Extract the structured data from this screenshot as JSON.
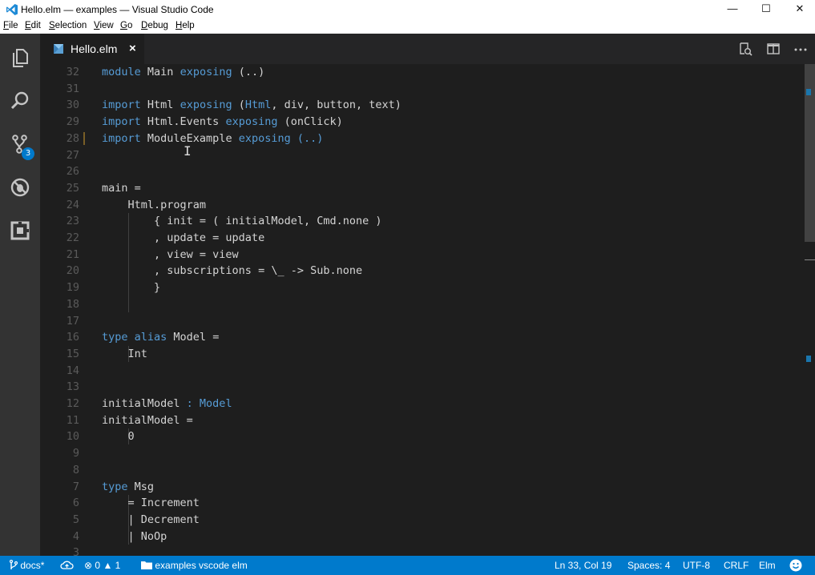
{
  "window": {
    "title": "Hello.elm — examples — Visual Studio Code",
    "minimize": "—",
    "maximize": "☐",
    "close": "✕"
  },
  "menu": [
    {
      "mnemonic": "F",
      "rest": "ile"
    },
    {
      "mnemonic": "E",
      "rest": "dit"
    },
    {
      "mnemonic": "S",
      "rest": "election"
    },
    {
      "mnemonic": "V",
      "rest": "iew"
    },
    {
      "mnemonic": "G",
      "rest": "o"
    },
    {
      "mnemonic": "D",
      "rest": "ebug"
    },
    {
      "mnemonic": "H",
      "rest": "elp"
    }
  ],
  "activity": {
    "icons": [
      "explorer-icon",
      "search-icon",
      "source-control-icon",
      "debug-icon",
      "extensions-icon"
    ],
    "scm_badge": "3"
  },
  "tab": {
    "label": "Hello.elm",
    "close": "×"
  },
  "editor": {
    "lines": [
      {
        "num": "32",
        "tokens": [
          {
            "t": "module",
            "c": "kw"
          },
          {
            "t": " Main "
          },
          {
            "t": "exposing",
            "c": "kw"
          },
          {
            "t": " (..)"
          }
        ]
      },
      {
        "num": "31",
        "tokens": []
      },
      {
        "num": "30",
        "tokens": [
          {
            "t": "import",
            "c": "kw"
          },
          {
            "t": " Html "
          },
          {
            "t": "exposing",
            "c": "kw"
          },
          {
            "t": " ("
          },
          {
            "t": "Html",
            "c": "kw"
          },
          {
            "t": ", div, button, text)"
          }
        ]
      },
      {
        "num": "29",
        "tokens": [
          {
            "t": "import",
            "c": "kw"
          },
          {
            "t": " Html.Events "
          },
          {
            "t": "exposing",
            "c": "kw"
          },
          {
            "t": " (onClick)"
          }
        ]
      },
      {
        "num": "28",
        "tokens": [
          {
            "t": "import",
            "c": "kw"
          },
          {
            "t": " ModuleExample "
          },
          {
            "t": "exposing",
            "c": "kw"
          },
          {
            "t": " (..)",
            "c": "kw"
          }
        ],
        "modified": true
      },
      {
        "num": "27",
        "tokens": []
      },
      {
        "num": "26",
        "tokens": []
      },
      {
        "num": "25",
        "tokens": [
          {
            "t": "main ="
          }
        ]
      },
      {
        "num": "24",
        "tokens": [
          {
            "t": "    Html.program"
          }
        ]
      },
      {
        "num": "23",
        "tokens": [
          {
            "t": "        { init = ( initialModel, Cmd.none )"
          }
        ]
      },
      {
        "num": "22",
        "tokens": [
          {
            "t": "        , update = update"
          }
        ]
      },
      {
        "num": "21",
        "tokens": [
          {
            "t": "        , view = view"
          }
        ]
      },
      {
        "num": "20",
        "tokens": [
          {
            "t": "        , subscriptions = \\_ -> Sub.none"
          }
        ]
      },
      {
        "num": "19",
        "tokens": [
          {
            "t": "        }"
          }
        ]
      },
      {
        "num": "18",
        "tokens": []
      },
      {
        "num": "17",
        "tokens": []
      },
      {
        "num": "16",
        "tokens": [
          {
            "t": "type",
            "c": "kw"
          },
          {
            "t": " "
          },
          {
            "t": "alias",
            "c": "kw"
          },
          {
            "t": " Model ="
          }
        ]
      },
      {
        "num": "15",
        "tokens": [
          {
            "t": "    Int"
          }
        ]
      },
      {
        "num": "14",
        "tokens": []
      },
      {
        "num": "13",
        "tokens": []
      },
      {
        "num": "12",
        "tokens": [
          {
            "t": "initialModel "
          },
          {
            "t": ": Model",
            "c": "kw"
          }
        ]
      },
      {
        "num": "11",
        "tokens": [
          {
            "t": "initialModel ="
          }
        ]
      },
      {
        "num": "10",
        "tokens": [
          {
            "t": "    0"
          }
        ]
      },
      {
        "num": "9",
        "tokens": []
      },
      {
        "num": "8",
        "tokens": []
      },
      {
        "num": "7",
        "tokens": [
          {
            "t": "type",
            "c": "kw"
          },
          {
            "t": " Msg"
          }
        ]
      },
      {
        "num": "6",
        "tokens": [
          {
            "t": "    = Increment"
          }
        ]
      },
      {
        "num": "5",
        "tokens": [
          {
            "t": "    | Decrement"
          }
        ]
      },
      {
        "num": "4",
        "tokens": [
          {
            "t": "    | NoOp"
          }
        ]
      },
      {
        "num": "3",
        "tokens": []
      }
    ]
  },
  "status": {
    "branch": "docs*",
    "errors": "0",
    "warnings": "1",
    "folder": "examples vscode elm",
    "position": "Ln 33, Col 19",
    "spaces": "Spaces: 4",
    "encoding": "UTF-8",
    "eol": "CRLF",
    "language": "Elm"
  },
  "colors": {
    "accent": "#007acc",
    "keyword": "#569cd6",
    "text": "#d4d4d4",
    "line_number": "#5a5a5a"
  }
}
